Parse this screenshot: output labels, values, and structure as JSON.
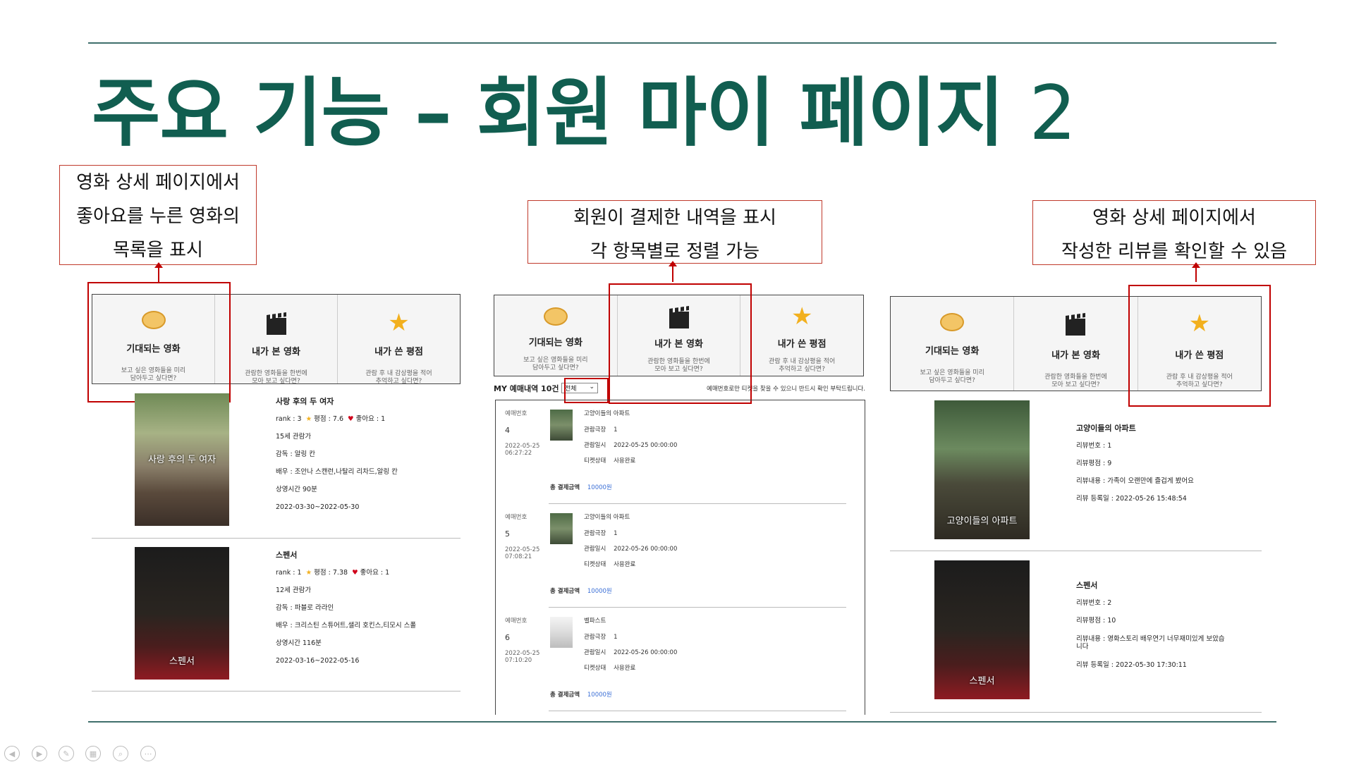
{
  "slide": {
    "title_main": "주요 기능 – 회원 마이 페이지",
    "title_num": "2"
  },
  "callouts": {
    "left": [
      "영화 상세 페이지에서",
      "좋아요를 누른 영화의",
      "목록을 표시"
    ],
    "middle": [
      "회원이 결제한 내역을 표시",
      "각 항목별로 정렬 가능"
    ],
    "right": [
      "영화 상세 페이지에서",
      "작성한 리뷰를 확인할 수 있음"
    ]
  },
  "tabs": [
    {
      "icon": "egg-icon",
      "label": "기대되는 영화",
      "sub1": "보고 싶은 영화들을 미리",
      "sub2": "담아두고 싶다면?"
    },
    {
      "icon": "clapperboard-icon",
      "label": "내가 본 영화",
      "sub1": "관람한 영화들을 한번에",
      "sub2": "모아 보고 싶다면?"
    },
    {
      "icon": "star-icon",
      "label": "내가 쓴 평점",
      "sub1": "관람 후 내 감상평을 적어",
      "sub2": "추억하고 싶다면?"
    }
  ],
  "liked": [
    {
      "title": "사랑 후의 두 여자",
      "rank": "rank : 3",
      "rating": "평점 : 7.6",
      "likes": "좋아요 : 1",
      "age": "15세 관람가",
      "director": "감독 : 알링 칸",
      "actors": "배우 : 조안나 스캔런,나탈리 리차드,알링 칸",
      "runtime": "상영시간 90분",
      "period": "2022-03-30~2022-05-30",
      "poster_text": "사랑 후의 두 여자"
    },
    {
      "title": "스펜서",
      "rank": "rank : 1",
      "rating": "평점 : 7.38",
      "likes": "좋아요 : 1",
      "age": "12세 관람가",
      "director": "감독 : 파블로 라라인",
      "actors": "배우 : 크리스틴 스튜어트,샐리 호킨스,티모시 스폴",
      "runtime": "상영시간 116분",
      "period": "2022-03-16~2022-05-16",
      "poster_text": "스펜서"
    }
  ],
  "reservations": {
    "header_label": "MY 예매내역 10건",
    "sort_value": "전체",
    "notice": "예매번호로만 티켓을 찾을 수 있으니 반드시 확인 부탁드립니다.",
    "col_label": "예매번호",
    "items": [
      {
        "no": "4",
        "date": "2022-05-25",
        "time": "06:27:22",
        "movie": "고양이들의 아파트",
        "theater_label": "관람극장",
        "theater": "1",
        "view_label": "관람일시",
        "view": "2022-05-25   00:00:00",
        "status_label": "티켓상태",
        "status": "사용완료",
        "total_label": "총 결제금액",
        "total": "10000원"
      },
      {
        "no": "5",
        "date": "2022-05-25",
        "time": "07:08:21",
        "movie": "고양이들의 아파트",
        "theater_label": "관람극장",
        "theater": "1",
        "view_label": "관람일시",
        "view": "2022-05-26   00:00:00",
        "status_label": "티켓상태",
        "status": "사용완료",
        "total_label": "총 결제금액",
        "total": "10000원"
      },
      {
        "no": "6",
        "date": "2022-05-25",
        "time": "07:10:20",
        "movie": "벨파스트",
        "theater_label": "관람극장",
        "theater": "1",
        "view_label": "관람일시",
        "view": "2022-05-26   00:00:00",
        "status_label": "티켓상태",
        "status": "사용완료",
        "total_label": "총 결제금액",
        "total": "10000원"
      }
    ]
  },
  "reviews": [
    {
      "title": "고양이들의 아파트",
      "no": "리뷰번호 : 1",
      "score": "리뷰평점 : 9",
      "content": "리뷰내용 : 가족이 오랜만에 즐겁게 봤어요",
      "content2": "",
      "date": "리뷰 등록일 : 2022-05-26 15:48:54",
      "poster_text": "고양이들의 아파트"
    },
    {
      "title": "스펜서",
      "no": "리뷰번호 : 2",
      "score": "리뷰평점 : 10",
      "content": "리뷰내용 : 영화스토리 배우연기 너무재미있게 보았습",
      "content2": "니다",
      "date": "리뷰 등록일 : 2022-05-30 17:30:11",
      "poster_text": "스펜서"
    }
  ],
  "colors": {
    "title": "#115e50",
    "rule": "#3f6f6c",
    "highlight": "#c00000",
    "link": "#3b6fd6"
  }
}
